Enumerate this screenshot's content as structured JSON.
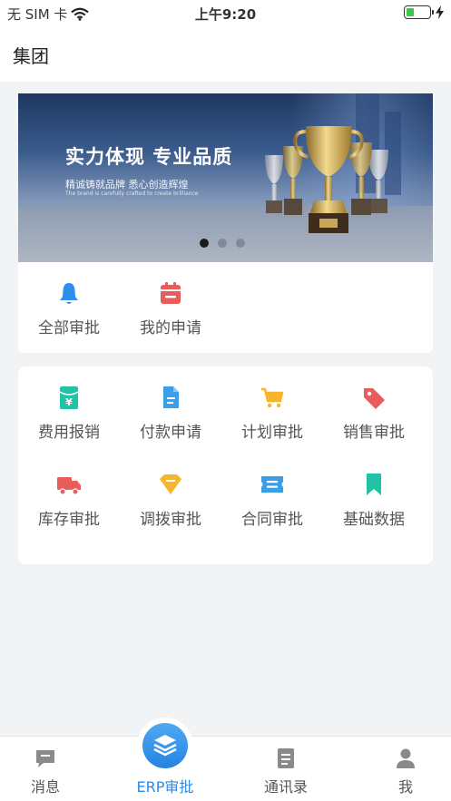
{
  "status_bar": {
    "carrier": "无 SIM 卡",
    "time": "上午9:20",
    "battery_level": 0.35
  },
  "header": {
    "title": "集团"
  },
  "banner": {
    "title": "实力体现  专业品质",
    "subtitle": "精诚铸就品牌  悉心创造辉煌",
    "caption": "The brand is carefully crafted to create brilliance",
    "slide_count": 3,
    "active_slide": 1
  },
  "quick_actions": [
    {
      "label": "全部审批",
      "icon": "bell-icon",
      "color": "#2f8ff0"
    },
    {
      "label": "我的申请",
      "icon": "calendar-icon",
      "color": "#ea5b5b"
    }
  ],
  "modules": [
    {
      "label": "费用报销",
      "icon": "yen-envelope-icon",
      "color": "#22c3a5"
    },
    {
      "label": "付款申请",
      "icon": "document-icon",
      "color": "#3a9ee8"
    },
    {
      "label": "计划审批",
      "icon": "shopping-cart-icon",
      "color": "#f6b52a"
    },
    {
      "label": "销售审批",
      "icon": "tag-icon",
      "color": "#ea5b5b"
    },
    {
      "label": "库存审批",
      "icon": "truck-icon",
      "color": "#ea5b5b"
    },
    {
      "label": "调拨审批",
      "icon": "diamond-icon",
      "color": "#f6b52a"
    },
    {
      "label": "合同审批",
      "icon": "ticket-icon",
      "color": "#3a9ee8"
    },
    {
      "label": "基础数据",
      "icon": "bookmark-icon",
      "color": "#22c3a5"
    }
  ],
  "tab_bar": {
    "active_index": 1,
    "active_color": "#2d89e8",
    "items": [
      {
        "label": "消息",
        "icon": "chat-icon"
      },
      {
        "label": "ERP审批",
        "icon": "layers-icon"
      },
      {
        "label": "通讯录",
        "icon": "contacts-icon"
      },
      {
        "label": "我",
        "icon": "user-icon"
      }
    ]
  }
}
